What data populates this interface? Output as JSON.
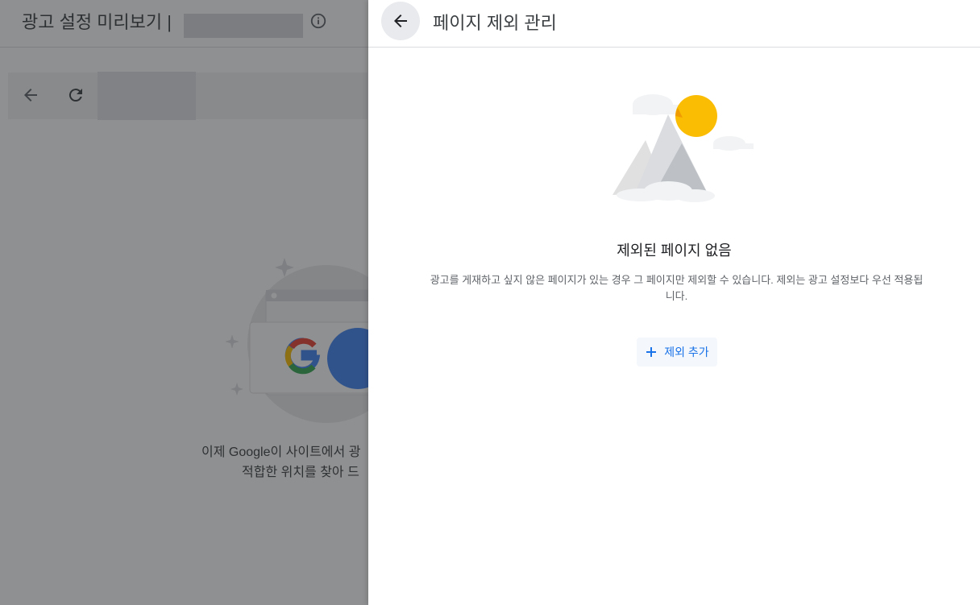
{
  "background": {
    "title": "광고 설정 미리보기 |",
    "description_line1": "이제 Google이 사이트에서 광",
    "description_line2": "적합한 위치를 찾아 드"
  },
  "panel": {
    "title": "페이지 제외 관리",
    "empty_title": "제외된 페이지 없음",
    "empty_description": "광고를 게재하고 싶지 않은 페이지가 있는 경우 그 페이지만 제외할 수 있습니다. 제외는 광고 설정보다 우선 적용됩니다.",
    "add_button_label": "제외 추가"
  },
  "colors": {
    "accent": "#1a73e8",
    "sun": "#fbbc04",
    "scrim": "rgba(32,33,36,0.5)"
  },
  "icons": [
    "info-icon",
    "back-arrow-icon",
    "reload-icon",
    "google-logo-icon",
    "plus-icon"
  ]
}
